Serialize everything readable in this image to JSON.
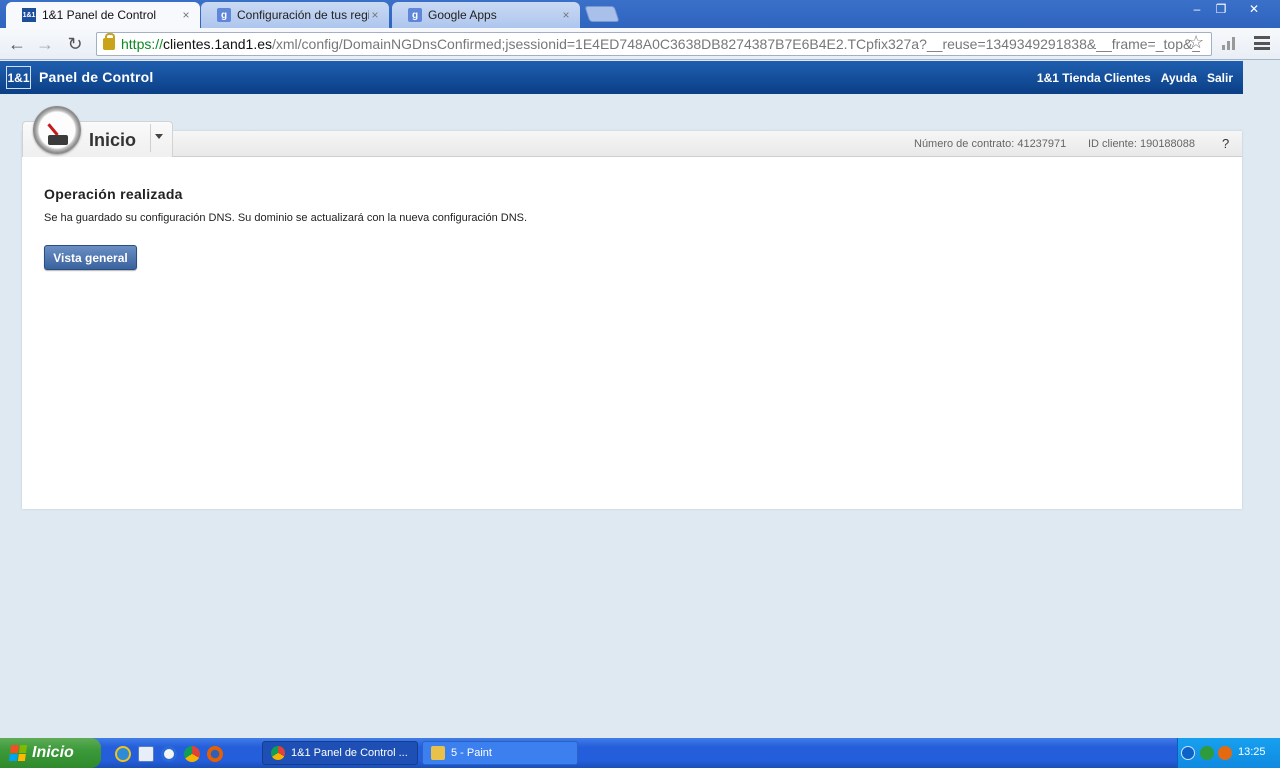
{
  "browser": {
    "tabs": [
      {
        "label": "1&1 Panel de Control",
        "active": true
      },
      {
        "label": "Configuración de tus registros",
        "active": false
      },
      {
        "label": "Google Apps",
        "active": false
      }
    ],
    "tab_close": "×",
    "url": {
      "scheme": "https://",
      "host": "clientes.1and1.es",
      "rest": "/xml/config/DomainNGDnsConfirmed;jsessionid=1E4ED748A0C3638DB8274387B7E6B4E2.TCpfix327a?__reuse=1349349291838&__frame=_top&_"
    },
    "window_controls": {
      "minimize": "–",
      "restore": "❐",
      "close": "✕"
    }
  },
  "site": {
    "logo": "1&1",
    "title": "Panel de Control",
    "links": [
      "1&1 Tienda Clientes",
      "Ayuda",
      "Salir"
    ]
  },
  "panel": {
    "section_title": "Inicio",
    "contract": "Número de contrato: 41237971",
    "client_id": "ID cliente: 190188088",
    "help": "?",
    "message_title": "Operación realizada",
    "message_text": "Se ha guardado su configuración DNS. Su dominio se actualizará con la nueva configuración DNS.",
    "button_label": "Vista general"
  },
  "taskbar": {
    "start_label": "Inicio",
    "windows": [
      {
        "label": "1&1 Panel de Control ...",
        "active": true
      },
      {
        "label": "5 - Paint",
        "active": false
      }
    ],
    "clock": "13:25"
  },
  "colors": {
    "header_blue": "#0b3f86",
    "button_blue": "#3a629e",
    "taskbar_blue": "#245edb",
    "start_green": "#3c9a3a"
  }
}
